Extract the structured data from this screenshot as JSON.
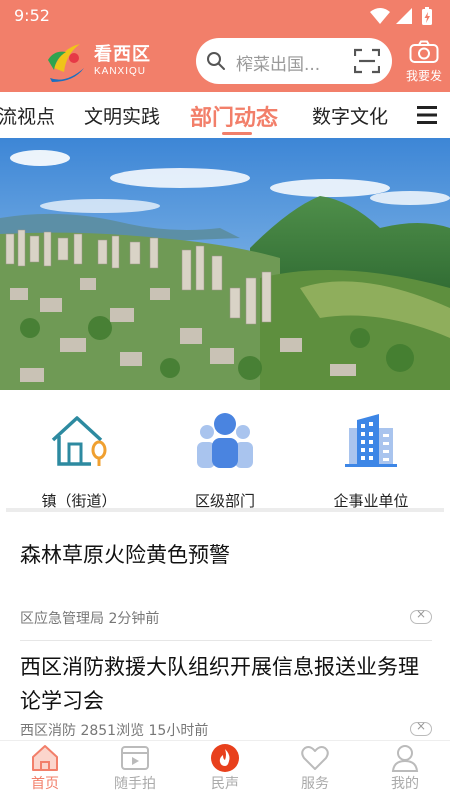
{
  "status": {
    "time": "9:52"
  },
  "app": {
    "name": "看西区",
    "name_en": "KANXIQU",
    "brand_color": "#f27f6a"
  },
  "search": {
    "placeholder": "榨菜出国..."
  },
  "post": {
    "label": "我要发"
  },
  "tabs": [
    {
      "label": "流视点",
      "active": false
    },
    {
      "label": "文明实践",
      "active": false
    },
    {
      "label": "部门动态",
      "active": true
    },
    {
      "label": "数字文化",
      "active": false
    }
  ],
  "categories": [
    {
      "label": "镇（街道）",
      "icon": "house-icon"
    },
    {
      "label": "区级部门",
      "icon": "people-icon"
    },
    {
      "label": "企事业单位",
      "icon": "building-icon"
    }
  ],
  "news": [
    {
      "title": "森林草原火险黄色预警",
      "meta": "区应急管理局 2分钟前"
    },
    {
      "title": "西区消防救援大队组织开展信息报送业务理论学习会",
      "meta": "西区消防 2851浏览 15小时前"
    }
  ],
  "bottom_nav": [
    {
      "label": "首页",
      "icon": "home-icon",
      "active": true
    },
    {
      "label": "随手拍",
      "icon": "video-icon",
      "active": false
    },
    {
      "label": "民声",
      "icon": "flame-icon",
      "active": false
    },
    {
      "label": "服务",
      "icon": "heart-icon",
      "active": false
    },
    {
      "label": "我的",
      "icon": "user-icon",
      "active": false
    }
  ]
}
